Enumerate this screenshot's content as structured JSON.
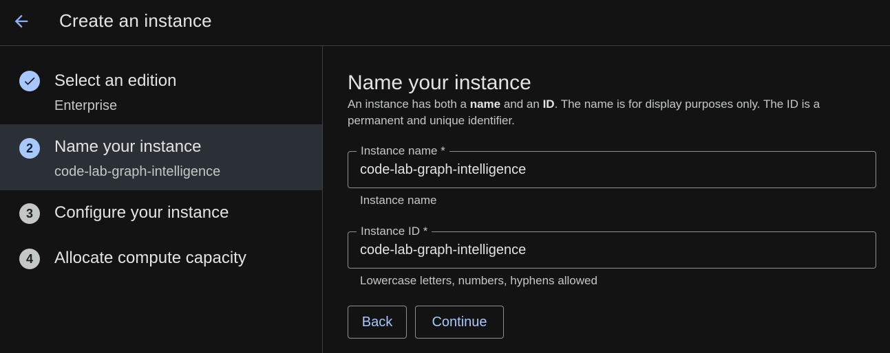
{
  "header": {
    "title": "Create an instance",
    "back_icon": "arrow-back-icon",
    "accent_color": "#8ab4f8"
  },
  "steps": [
    {
      "badge": "",
      "icon": "check-circle-icon",
      "title": "Select an edition",
      "subtitle": "Enterprise",
      "status": "done"
    },
    {
      "badge": "2",
      "title": "Name your instance",
      "subtitle": "code-lab-graph-intelligence",
      "status": "active"
    },
    {
      "badge": "3",
      "title": "Configure your instance",
      "status": "todo"
    },
    {
      "badge": "4",
      "title": "Allocate compute capacity",
      "status": "todo"
    }
  ],
  "main": {
    "title": "Name your instance",
    "description": {
      "part1": "An instance has both a ",
      "bold1": "name",
      "part2": " and an ",
      "bold2": "ID",
      "part3": ". The name is for display purposes only. The ID is a permanent and unique identifier."
    },
    "fields": [
      {
        "label": "Instance name *",
        "value": "code-lab-graph-intelligence",
        "hint": "Instance name"
      },
      {
        "label": "Instance ID *",
        "value": "code-lab-graph-intelligence",
        "hint": "Lowercase letters, numbers, hyphens allowed"
      }
    ],
    "buttons": {
      "back": "Back",
      "continue": "Continue"
    }
  }
}
